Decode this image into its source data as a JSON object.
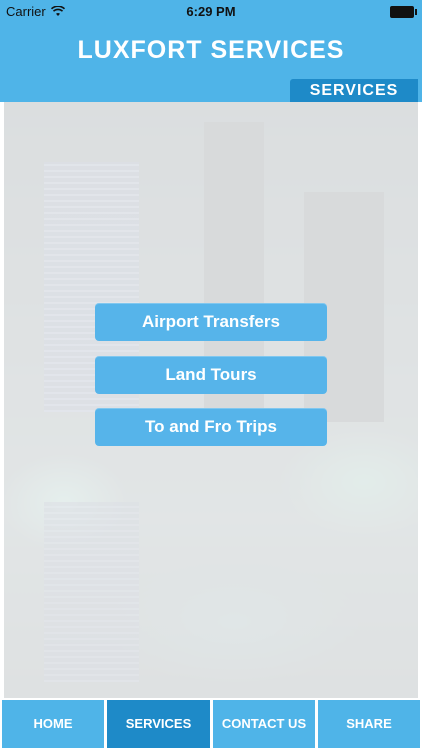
{
  "status_bar": {
    "carrier": "Carrier",
    "time": "6:29 PM",
    "wifi_icon": "wifi-icon",
    "battery_icon": "battery-icon"
  },
  "header": {
    "title": "LUXFORT SERVICES",
    "section_tab": "SERVICES"
  },
  "colors": {
    "header_blue": "#4fb4e8",
    "active_tab_blue": "#1e8ac8",
    "button_blue": "#56b4ea"
  },
  "services": [
    {
      "label": "Airport Transfers"
    },
    {
      "label": "Land Tours"
    },
    {
      "label": "To and Fro Trips"
    }
  ],
  "tabbar": {
    "items": [
      {
        "label": "HOME"
      },
      {
        "label": "SERVICES"
      },
      {
        "label": "CONTACT US"
      },
      {
        "label": "SHARE"
      }
    ],
    "active": "SERVICES"
  }
}
